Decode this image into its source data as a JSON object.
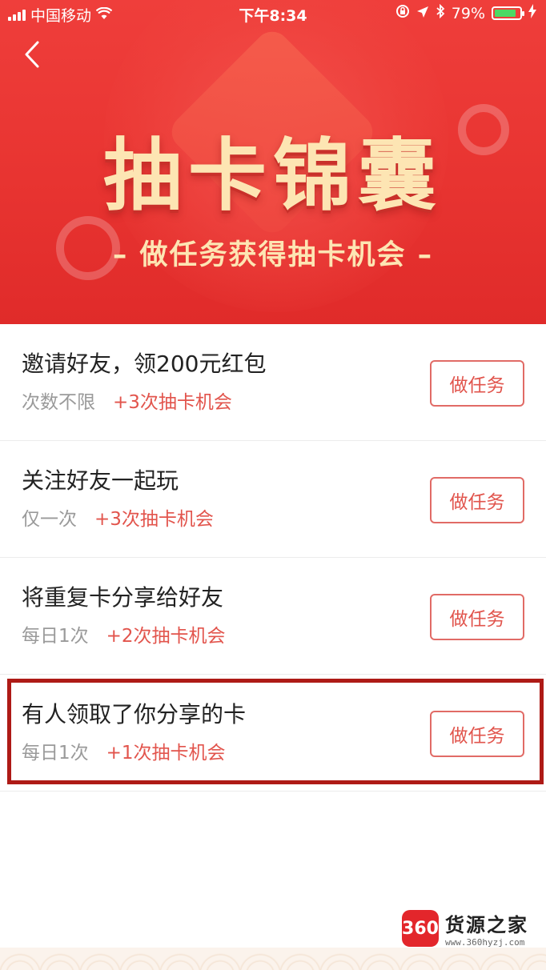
{
  "status_bar": {
    "carrier": "中国移动",
    "time": "下午8:34",
    "battery": "79%",
    "icons": [
      "signal-icon",
      "wifi-icon",
      "lock-rotation-icon",
      "location-icon",
      "bluetooth-icon",
      "battery-icon",
      "charging-icon"
    ]
  },
  "header": {
    "back_icon": "chevron-left-icon",
    "title": "抽卡锦囊",
    "subtitle": "– 做任务获得抽卡机会 –"
  },
  "tasks": [
    {
      "title": "邀请好友，领200元红包",
      "frequency": "次数不限",
      "reward": "+3次抽卡机会",
      "button": "做任务"
    },
    {
      "title": "关注好友一起玩",
      "frequency": "仅一次",
      "reward": "+3次抽卡机会",
      "button": "做任务"
    },
    {
      "title": "将重复卡分享给好友",
      "frequency": "每日1次",
      "reward": "+2次抽卡机会",
      "button": "做任务"
    },
    {
      "title": "有人领取了你分享的卡",
      "frequency": "每日1次",
      "reward": "+1次抽卡机会",
      "button": "做任务"
    }
  ],
  "watermark": {
    "logo": "360",
    "name": "货源之家",
    "url": "www.360hyzj.com"
  },
  "colors": {
    "hero_red": "#e83431",
    "title_gold": "#fde5b3",
    "accent": "#e2544c",
    "highlight": "#ae1a16"
  }
}
